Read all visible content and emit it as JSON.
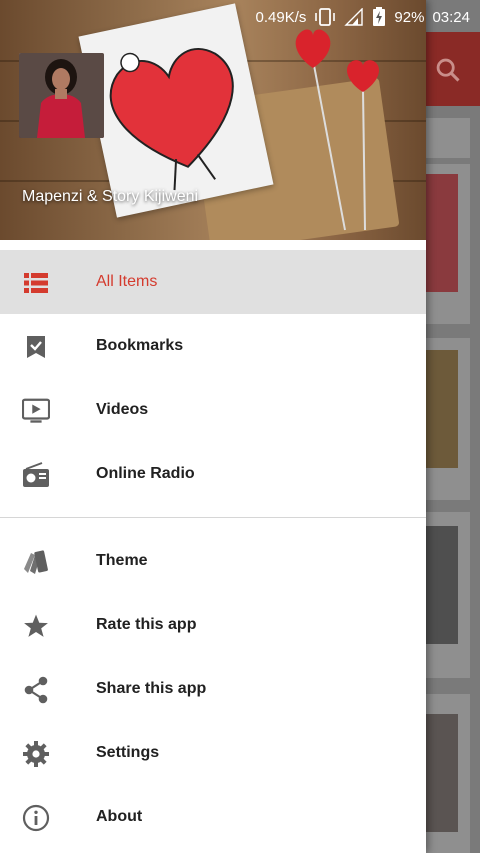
{
  "status_bar": {
    "speed": "0.49K/s",
    "battery": "92%",
    "time": "03:24"
  },
  "drawer": {
    "header_title": "Mapenzi & Story Kijiweni",
    "accent_color": "#d43b2e",
    "primary_items": [
      {
        "label": "All Items",
        "icon": "list-icon",
        "active": true
      },
      {
        "label": "Bookmarks",
        "icon": "bookmark-icon",
        "active": false
      },
      {
        "label": "Videos",
        "icon": "video-icon",
        "active": false
      },
      {
        "label": "Online Radio",
        "icon": "radio-icon",
        "active": false
      }
    ],
    "secondary_items": [
      {
        "label": "Theme",
        "icon": "theme-icon"
      },
      {
        "label": "Rate this app",
        "icon": "star-icon"
      },
      {
        "label": "Share this app",
        "icon": "share-icon"
      },
      {
        "label": "Settings",
        "icon": "gear-icon"
      },
      {
        "label": "About",
        "icon": "info-icon"
      }
    ]
  }
}
